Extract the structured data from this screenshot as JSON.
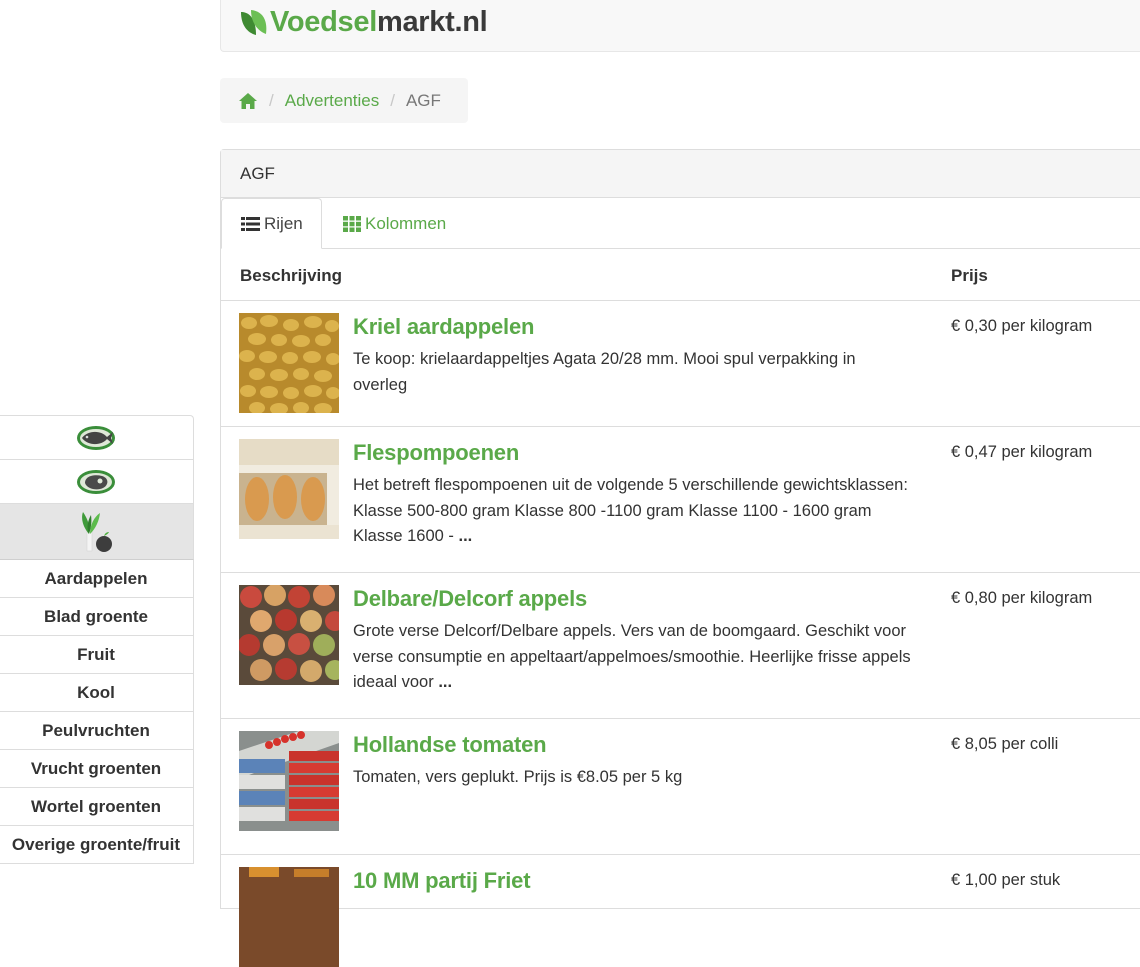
{
  "brand": {
    "name_part1": "Voedsel",
    "name_part2": "markt.nl",
    "accent_color": "#5aa949"
  },
  "breadcrumb": {
    "home_icon": "home-icon",
    "items": [
      "Advertenties",
      "AGF"
    ]
  },
  "panel": {
    "title": "AGF",
    "tabs": [
      {
        "label": "Rijen",
        "icon": "list-icon",
        "active": true
      },
      {
        "label": "Kolommen",
        "icon": "grid-icon",
        "active": false
      }
    ],
    "columns": {
      "description": "Beschrijving",
      "price": "Prijs"
    },
    "listings": [
      {
        "title": "Kriel aardappelen",
        "description": "Te koop: krielaardappeltjes Agata 20/28 mm. Mooi spul verpakking in overleg",
        "more": "",
        "price": "€ 0,30 per kilogram"
      },
      {
        "title": "Flespompoenen",
        "description": "Het betreft flespompoenen uit de volgende 5 verschillende gewichtsklassen: Klasse 500-800 gram Klasse 800 -1100 gram Klasse 1100 - 1600 gram Klasse 1600 -",
        "more": "...",
        "price": "€ 0,47 per kilogram"
      },
      {
        "title": "Delbare/Delcorf appels",
        "description": "Grote verse Delcorf/Delbare appels. Vers van de boomgaard. Geschikt voor verse consumptie en appeltaart/appelmoes/smoothie. Heerlijke frisse appels ideaal voor",
        "more": "...",
        "price": "€ 0,80 per kilogram"
      },
      {
        "title": "Hollandse tomaten",
        "description": "Tomaten, vers geplukt. Prijs is €8.05 per 5 kg",
        "more": "",
        "price": "€ 8,05 per colli"
      },
      {
        "title": "10 MM partij Friet",
        "description": "",
        "more": "",
        "price": "€ 1,00 per stuk"
      }
    ]
  },
  "sidebar": {
    "category_icons": [
      "fish-icon",
      "meat-icon",
      "vegetable-fruit-icon"
    ],
    "subcategories": [
      "Aardappelen",
      "Blad groente",
      "Fruit",
      "Kool",
      "Peulvruchten",
      "Vrucht groenten",
      "Wortel groenten",
      "Overige groente/fruit"
    ]
  }
}
